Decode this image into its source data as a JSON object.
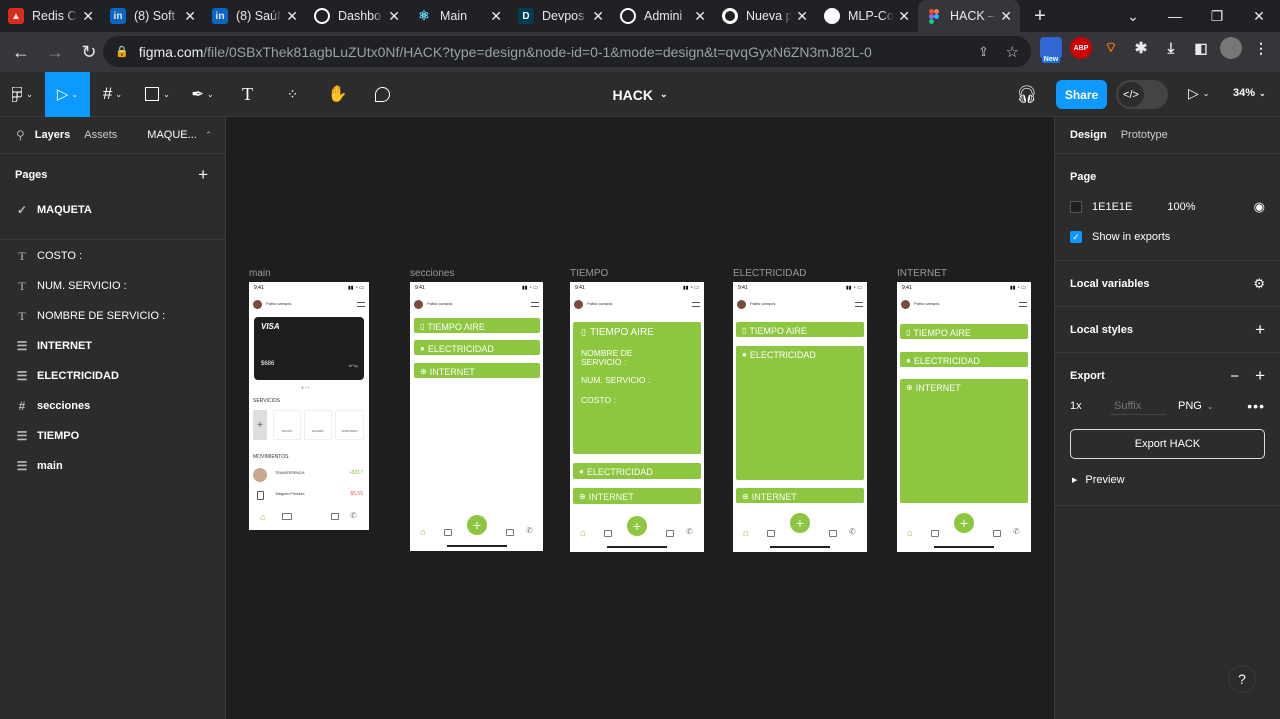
{
  "browser": {
    "tabs": [
      {
        "title": "Redis C",
        "icon": "redis-icon",
        "color": "#d82c20"
      },
      {
        "title": "(8) Soft",
        "icon": "linkedin-icon",
        "color": "#0a66c2"
      },
      {
        "title": "(8) SaúI",
        "icon": "linkedin-icon",
        "color": "#0a66c2"
      },
      {
        "title": "Dashbo",
        "icon": "circle-logo-icon",
        "color": "#ffffff"
      },
      {
        "title": "Main",
        "icon": "react-icon",
        "color": "#61dafb"
      },
      {
        "title": "Devpos",
        "icon": "devpost-icon",
        "color": "#003e54"
      },
      {
        "title": "Admini",
        "icon": "circle-logo-icon",
        "color": "#ffffff"
      },
      {
        "title": "Nueva p",
        "icon": "chrome-icon",
        "color": "#ffffff"
      },
      {
        "title": "MLP-Co",
        "icon": "github-icon",
        "color": "#ffffff"
      },
      {
        "title": "HACK –",
        "icon": "figma-icon",
        "color": "#f24e1e"
      }
    ],
    "url_host": "figma.com",
    "url_path": "/file/0SBxThek81agbLuZUtx0Nf/HACK?type=design&node-id=0-1&mode=design&t=qvqGyxN6ZN3mJ82L-0",
    "ext_new_badge": "New",
    "ext_abp": "ABP"
  },
  "toolbar": {
    "file_title": "HACK",
    "share_label": "Share",
    "zoom": "34%"
  },
  "left_panel": {
    "tab_layers": "Layers",
    "tab_assets": "Assets",
    "page_select": "MAQUE...",
    "pages_heading": "Pages",
    "pages": [
      "MAQUETA"
    ],
    "layers": [
      {
        "label": "COSTO :",
        "icon": "text-layer-icon",
        "glyph": "T"
      },
      {
        "label": "NUM. SERVICIO :",
        "icon": "text-layer-icon",
        "glyph": "T"
      },
      {
        "label": "NOMBRE DE SERVICIO :",
        "icon": "text-layer-icon",
        "glyph": "T"
      },
      {
        "label": "INTERNET",
        "icon": "frame-layer-icon",
        "glyph": "☰"
      },
      {
        "label": "ELECTRICIDAD",
        "icon": "frame-layer-icon",
        "glyph": "☰"
      },
      {
        "label": "secciones",
        "icon": "hash-frame-icon",
        "glyph": "#"
      },
      {
        "label": "TIEMPO",
        "icon": "frame-layer-icon",
        "glyph": "☰"
      },
      {
        "label": "main",
        "icon": "frame-layer-icon",
        "glyph": "☰"
      }
    ]
  },
  "canvas": {
    "frames": {
      "main": {
        "label": "main",
        "time": "9:41",
        "user": "Pablo campos",
        "card_brand": "VISA",
        "card_balance": "$686",
        "section_services": "SERVICIOS",
        "services": [
          "PAGOS",
          "ENVIAR",
          "APARTADO"
        ],
        "section_movements": "MOVIMIENTOS",
        "movements": [
          {
            "name": "TRANSFERENCIA",
            "amount": "+$317"
          },
          {
            "name": "Telegram Premium",
            "amount": "$5,55"
          }
        ],
        "nav": [
          "HOME",
          "WALLET",
          "HISTORIAL",
          "AYUDA"
        ]
      },
      "secciones": {
        "label": "secciones",
        "time": "9:41",
        "user": "Pablo campos",
        "bars": [
          "TIEMPO AIRE",
          "ELECTRICIDAD",
          "INTERNET"
        ]
      },
      "tiempo": {
        "label": "TIEMPO",
        "time": "9:41",
        "user": "Pablo campos",
        "title": "TIEMPO AIRE",
        "field_name": "NOMBRE DE SERVICIO :",
        "field_num": "NUM. SERVICIO :",
        "field_cost": "COSTO :",
        "bars": [
          "ELECTRICIDAD",
          "INTERNET"
        ]
      },
      "electricidad": {
        "label": "ELECTRICIDAD",
        "time": "9:41",
        "user": "Pablo campos",
        "bars": [
          "TIEMPO AIRE",
          "ELECTRICIDAD",
          "INTERNET"
        ]
      },
      "internet": {
        "label": "INTERNET",
        "time": "9:41",
        "user": "Pablo campos",
        "bars": [
          "TIEMPO AIRE",
          "ELECTRICIDAD",
          "INTERNET"
        ]
      }
    }
  },
  "right_panel": {
    "tab_design": "Design",
    "tab_prototype": "Prototype",
    "page_heading": "Page",
    "bg_hex": "1E1E1E",
    "bg_opacity": "100%",
    "show_in_exports": "Show in exports",
    "local_variables": "Local variables",
    "local_styles": "Local styles",
    "export_heading": "Export",
    "export_scale": "1x",
    "export_suffix_placeholder": "Suffix",
    "export_format": "PNG",
    "export_button": "Export HACK",
    "preview": "Preview"
  },
  "colors": {
    "accent": "#0d99ff",
    "frame_green": "#8dc63f",
    "canvas_bg": "#1e1e1e"
  }
}
